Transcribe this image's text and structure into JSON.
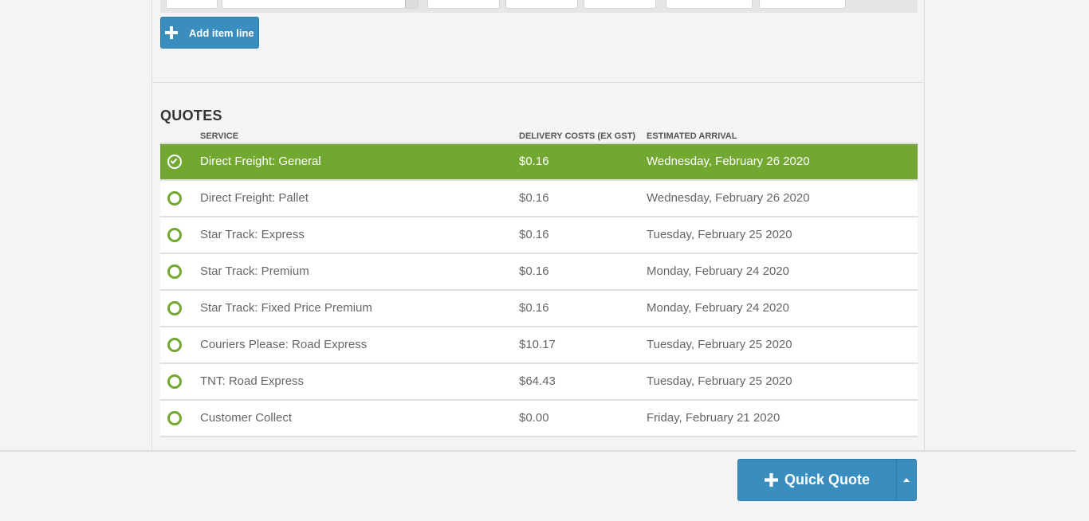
{
  "actions": {
    "add_item_line_label": "Add item line",
    "quick_quote_label": "Quick Quote"
  },
  "quotes": {
    "title": "QUOTES",
    "columns": {
      "service": "SERVICE",
      "delivery_costs": "DELIVERY COSTS (EX GST)",
      "estimated_arrival": "ESTIMATED ARRIVAL"
    },
    "selected_index": 0,
    "rows": [
      {
        "service": "Direct Freight: General",
        "cost": "$0.16",
        "arrival": "Wednesday, February 26 2020"
      },
      {
        "service": "Direct Freight: Pallet",
        "cost": "$0.16",
        "arrival": "Wednesday, February 26 2020"
      },
      {
        "service": "Star Track: Express",
        "cost": "$0.16",
        "arrival": "Tuesday, February 25 2020"
      },
      {
        "service": "Star Track: Premium",
        "cost": "$0.16",
        "arrival": "Monday, February 24 2020"
      },
      {
        "service": "Star Track: Fixed Price Premium",
        "cost": "$0.16",
        "arrival": "Monday, February 24 2020"
      },
      {
        "service": "Couriers Please: Road Express",
        "cost": "$10.17",
        "arrival": "Tuesday, February 25 2020"
      },
      {
        "service": "TNT: Road Express",
        "cost": "$64.43",
        "arrival": "Tuesday, February 25 2020"
      },
      {
        "service": "Customer Collect",
        "cost": "$0.00",
        "arrival": "Friday, February 21 2020"
      }
    ]
  },
  "icons": {
    "add": "plus-icon",
    "selected": "check-circle-icon",
    "unselected": "radio-circle-icon",
    "menu": "caret-up-icon"
  },
  "colors": {
    "accent_blue": "#3a8dbf",
    "selected_green": "#72a832",
    "background": "#f4f4f4"
  }
}
